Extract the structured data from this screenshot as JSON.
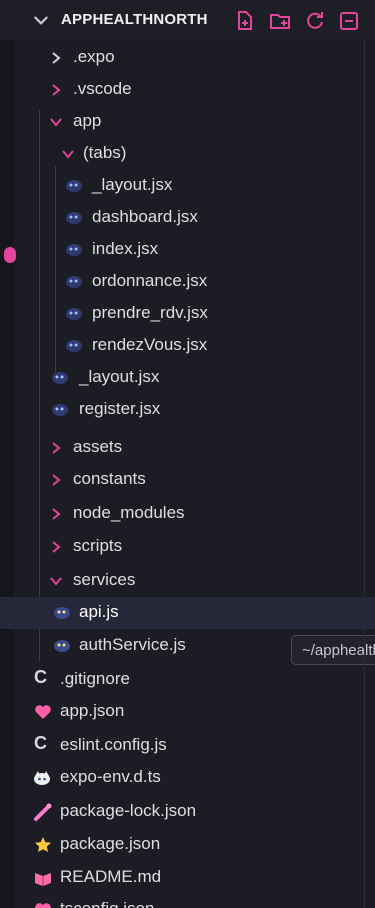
{
  "explorer": {
    "root_label": "APPHEALTHNORTH",
    "tooltip": "~/apphealth",
    "header_icons": [
      "new-file-icon",
      "new-folder-icon",
      "refresh-icon",
      "collapse-all-icon"
    ]
  },
  "tree": [
    {
      "label": ".expo",
      "type": "folder",
      "state": "collapsed",
      "icon": "chevron-right-icon"
    },
    {
      "label": ".vscode",
      "type": "folder",
      "state": "collapsed",
      "icon": "chevron-right-icon"
    },
    {
      "label": "app",
      "type": "folder",
      "state": "expanded",
      "icon": "chevron-down-icon"
    },
    {
      "label": "(tabs)",
      "type": "folder",
      "state": "expanded",
      "icon": "chevron-down-icon"
    },
    {
      "label": "_layout.jsx",
      "type": "file",
      "icon": "react-file-icon"
    },
    {
      "label": "dashboard.jsx",
      "type": "file",
      "icon": "react-file-icon"
    },
    {
      "label": "index.jsx",
      "type": "file",
      "icon": "react-file-icon"
    },
    {
      "label": "ordonnance.jsx",
      "type": "file",
      "icon": "react-file-icon"
    },
    {
      "label": "prendre_rdv.jsx",
      "type": "file",
      "icon": "react-file-icon"
    },
    {
      "label": "rendezVous.jsx",
      "type": "file",
      "icon": "react-file-icon"
    },
    {
      "label": "_layout.jsx",
      "type": "file",
      "icon": "react-file-icon"
    },
    {
      "label": "register.jsx",
      "type": "file",
      "icon": "react-file-icon"
    },
    {
      "label": "assets",
      "type": "folder",
      "state": "collapsed",
      "icon": "chevron-right-icon"
    },
    {
      "label": "constants",
      "type": "folder",
      "state": "collapsed",
      "icon": "chevron-right-icon"
    },
    {
      "label": "node_modules",
      "type": "folder",
      "state": "collapsed",
      "icon": "chevron-right-icon"
    },
    {
      "label": "scripts",
      "type": "folder",
      "state": "collapsed",
      "icon": "chevron-right-icon"
    },
    {
      "label": "services",
      "type": "folder",
      "state": "expanded",
      "icon": "chevron-down-icon"
    },
    {
      "label": "api.js",
      "type": "file",
      "icon": "js-file-icon",
      "selected": true
    },
    {
      "label": "authService.js",
      "type": "file",
      "icon": "js-file-icon"
    },
    {
      "label": ".gitignore",
      "type": "file",
      "icon": "gitignore-icon"
    },
    {
      "label": "app.json",
      "type": "file",
      "icon": "heart-json-icon"
    },
    {
      "label": "eslint.config.js",
      "type": "file",
      "icon": "eslint-icon"
    },
    {
      "label": "expo-env.d.ts",
      "type": "file",
      "icon": "expo-ts-icon"
    },
    {
      "label": "package-lock.json",
      "type": "file",
      "icon": "package-lock-icon"
    },
    {
      "label": "package.json",
      "type": "file",
      "icon": "package-star-icon"
    },
    {
      "label": "README.md",
      "type": "file",
      "icon": "readme-icon"
    },
    {
      "label": "tsconfig.json",
      "type": "file",
      "icon": "tsconfig-icon"
    }
  ],
  "colors": {
    "background": "#1c1d24",
    "selected_row": "#26283a",
    "accent_pink": "#e2459b",
    "text": "#dedee4"
  }
}
